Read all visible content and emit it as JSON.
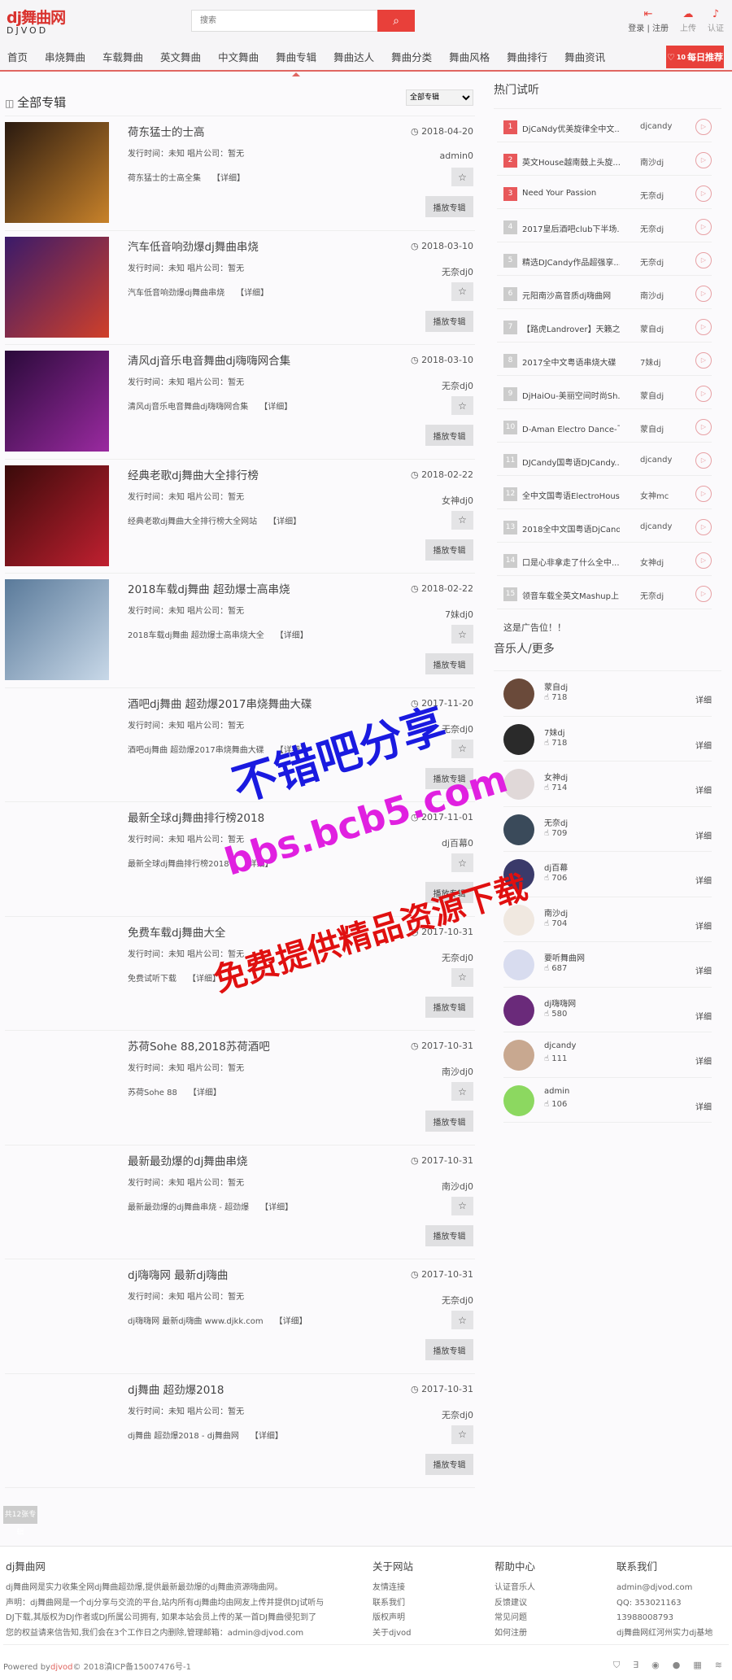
{
  "header": {
    "logo_text": "dj舞曲网",
    "logo_sub": "DJVOD",
    "search_placeholder": "搜索",
    "login": "登录",
    "register": "注册",
    "upload": "上传",
    "certify": "认证"
  },
  "nav": {
    "items": [
      "首页",
      "串烧舞曲",
      "车载舞曲",
      "英文舞曲",
      "中文舞曲",
      "舞曲专辑",
      "舞曲达人",
      "舞曲分类",
      "舞曲风格",
      "舞曲排行",
      "舞曲资讯"
    ],
    "active": "舞曲专辑",
    "daily_label": "每日推荐",
    "daily_badge": "10"
  },
  "main": {
    "section_title": "全部专辑",
    "filter_value": "全部专辑",
    "meta_text": "发行时间：未知 唱片公司：暂无",
    "detail_label": "【详细】",
    "play_label": "播放专辑",
    "total_label": "共12张专辑",
    "albums": [
      {
        "title": "荷东猛士的士高",
        "desc": "荷东猛士的士高全集",
        "date": "2018-04-20",
        "author": "admin0",
        "cover": [
          "#2a1a10",
          "#c8822a"
        ]
      },
      {
        "title": "汽车低音响劲爆dj舞曲串烧",
        "desc": "汽车低音响劲爆dj舞曲串烧",
        "date": "2018-03-10",
        "author": "无奈dj0",
        "cover": [
          "#3a1a6a",
          "#d0402a"
        ]
      },
      {
        "title": "清风dj音乐电音舞曲dj嗨嗨网合集",
        "desc": "清风dj音乐电音舞曲dj嗨嗨网合集",
        "date": "2018-03-10",
        "author": "无奈dj0",
        "cover": [
          "#2a0a3a",
          "#9a2aa0"
        ]
      },
      {
        "title": "经典老歌dj舞曲大全排行榜",
        "desc": "经典老歌dj舞曲大全排行榜大全网站",
        "date": "2018-02-22",
        "author": "女神dj0",
        "cover": [
          "#3a0a0a",
          "#c02030"
        ]
      },
      {
        "title": "2018车载dj舞曲 超劲爆士高串烧",
        "desc": "2018车载dj舞曲 超劲爆士高串烧大全",
        "date": "2018-02-22",
        "author": "7妹dj0",
        "cover": [
          "#5a7a9a",
          "#c8d8e8"
        ]
      },
      {
        "title": "酒吧dj舞曲 超劲爆2017串烧舞曲大碟",
        "desc": "酒吧dj舞曲 超劲爆2017串烧舞曲大碟",
        "date": "2017-11-20",
        "author": "无奈dj0",
        "cover": null
      },
      {
        "title": "最新全球dj舞曲排行榜2018",
        "desc": "最新全球dj舞曲排行榜2018",
        "date": "2017-11-01",
        "author": "dj百幕0",
        "cover": null
      },
      {
        "title": "免费车载dj舞曲大全",
        "desc": "免费试听下载",
        "date": "2017-10-31",
        "author": "无奈dj0",
        "cover": null
      },
      {
        "title": "苏荷Sohe 88,2018苏荷酒吧",
        "desc": "苏荷Sohe 88",
        "date": "2017-10-31",
        "author": "南沙dj0",
        "cover": null
      },
      {
        "title": "最新最劲爆的dj舞曲串烧",
        "desc": "最新最劲爆的dj舞曲串烧 - 超劲爆",
        "date": "2017-10-31",
        "author": "南沙dj0",
        "cover": null
      },
      {
        "title": "dj嗨嗨网 最新dj嗨曲",
        "desc": "dj嗨嗨网 最新dj嗨曲 www.djkk.com",
        "date": "2017-10-31",
        "author": "无奈dj0",
        "cover": null
      },
      {
        "title": "dj舞曲 超劲爆2018",
        "desc": "dj舞曲 超劲爆2018 - dj舞曲网",
        "date": "2017-10-31",
        "author": "无奈dj0",
        "cover": null
      }
    ]
  },
  "sidebar": {
    "hot_title": "热门试听",
    "hot": [
      {
        "n": "1",
        "name": "DjCaNdy优美旋律全中文...",
        "author": "djcandy"
      },
      {
        "n": "2",
        "name": "英文House越南鼓上头旋...",
        "author": "南沙dj"
      },
      {
        "n": "3",
        "name": "Need Your Passion",
        "author": "无奈dj"
      },
      {
        "n": "4",
        "name": "2017皇后酒吧club下半场...",
        "author": "无奈dj"
      },
      {
        "n": "5",
        "name": "精选DJCandy作品超强享...",
        "author": "无奈dj"
      },
      {
        "n": "6",
        "name": "元阳南沙高音质dj嗨曲网",
        "author": "南沙dj"
      },
      {
        "n": "7",
        "name": "【路虎Landrover】天籁之...",
        "author": "蒙自dj"
      },
      {
        "n": "8",
        "name": "2017全中文粤语串烧大碟",
        "author": "7妹dj"
      },
      {
        "n": "9",
        "name": "DjHaiOu-美丽空间时尚Sh...",
        "author": "蒙自dj"
      },
      {
        "n": "10",
        "name": "D-Aman Electro Dance-飞...",
        "author": "蒙自dj"
      },
      {
        "n": "11",
        "name": "DJCandy国粤语DJCandy...",
        "author": "djcandy"
      },
      {
        "n": "12",
        "name": "全中文国粤语ElectroHous...",
        "author": "女神mc"
      },
      {
        "n": "13",
        "name": "2018全中文国粤语DjCand...",
        "author": "djcandy"
      },
      {
        "n": "14",
        "name": "口是心非拿走了什么全中...",
        "author": "女神dj"
      },
      {
        "n": "15",
        "name": "领音车载全英文Mashup上...",
        "author": "无奈dj"
      }
    ],
    "ad_text": "这是广告位！！",
    "musicians_title": "音乐人/更多",
    "detail_label": "详细",
    "musicians": [
      {
        "name": "蒙自dj",
        "hot": "718",
        "color": "#6a4a3a"
      },
      {
        "name": "7妹dj",
        "hot": "718",
        "color": "#2a2a2a"
      },
      {
        "name": "女神dj",
        "hot": "714",
        "color": "#e0d8d8"
      },
      {
        "name": "无奈dj",
        "hot": "709",
        "color": "#3a4a5a"
      },
      {
        "name": "dj百幕",
        "hot": "706",
        "color": "#3a3a6a"
      },
      {
        "name": "南沙dj",
        "hot": "704",
        "color": "#f0e8e0"
      },
      {
        "name": "要听舞曲网",
        "hot": "687",
        "color": "#d8dcef"
      },
      {
        "name": "dj嗨嗨网",
        "hot": "580",
        "color": "#6a2a7a"
      },
      {
        "name": "djcandy",
        "hot": "111",
        "color": "#c8a890"
      },
      {
        "name": "admin",
        "hot": "106",
        "color": "#8cd860"
      }
    ]
  },
  "footer": {
    "about_title": "dj舞曲网",
    "about_lines": [
      "dj舞曲网是实力收集全网dj舞曲超劲爆,提供最新最劲爆的dj舞曲资源嗨曲网。",
      "声明：dj舞曲网是一个dj分享与交流的平台,站内所有dj舞曲均由网友上传并提供DJ试听与",
      "DJ下载,其版权为DJ作者或DJ所属公司拥有, 如果本站会员上传的某一首DJ舞曲侵犯到了",
      "您的权益请来信告知,我们会在3个工作日之内删除,管理邮箱：admin@djvod.com"
    ],
    "cols": [
      {
        "title": "关于网站",
        "links": [
          "友情连接",
          "联系我们",
          "版权声明",
          "关于djvod"
        ]
      },
      {
        "title": "帮助中心",
        "links": [
          "认证音乐人",
          "反馈建议",
          "常见问题",
          "如何注册"
        ]
      },
      {
        "title": "联系我们",
        "links": [
          "admin@djvod.com",
          "QQ: 353021163",
          "13988008793",
          "dj舞曲网红河州实力dj基地"
        ]
      }
    ],
    "powered_prefix": "Powered by",
    "powered_brand": "djvod",
    "powered_suffix": "© 2018滇ICP备15007476号-1"
  },
  "watermark": {
    "line1": "不错吧分享",
    "line2": "bbs.bcb5.com",
    "line3": "免费提供精品资源下载"
  },
  "colors": {
    "accent": "#e8403a",
    "nav_underline": "#e06661"
  }
}
